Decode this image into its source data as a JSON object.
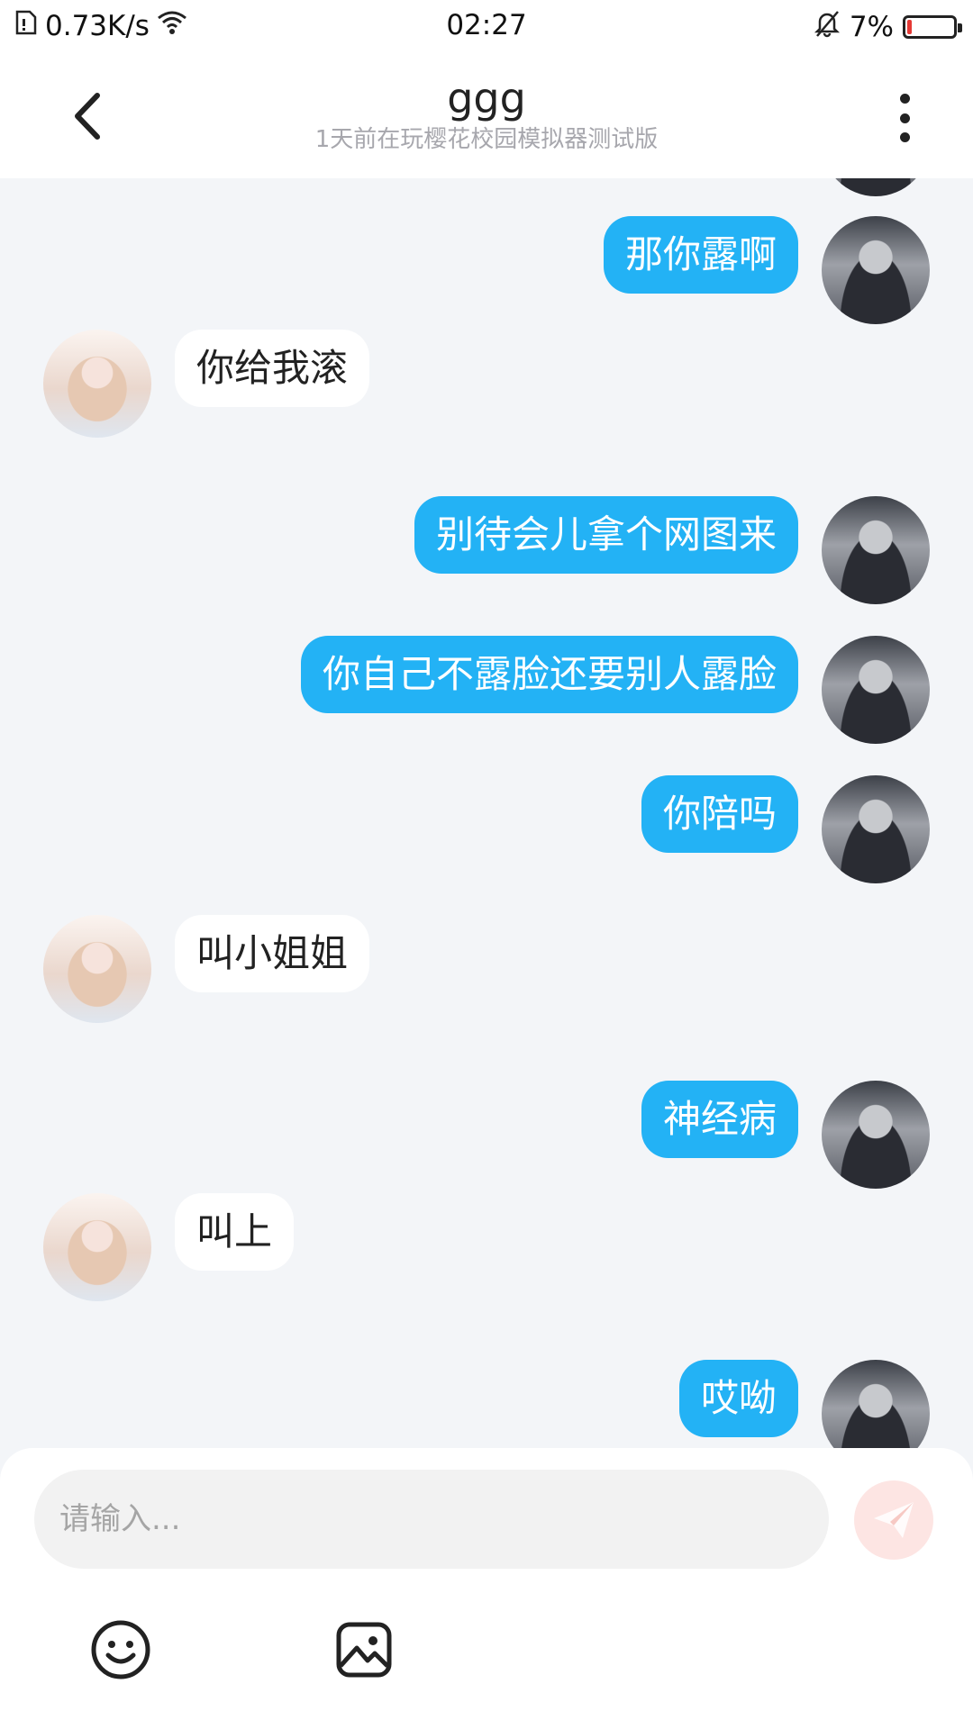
{
  "status_bar": {
    "network_speed": "0.73K/s",
    "time": "02:27",
    "battery": "7%",
    "battery_level": 0.07
  },
  "header": {
    "title": "ggg",
    "subtitle": "1天前在玩樱花校园模拟器测试版"
  },
  "messages": [
    {
      "sender": "me",
      "text": "那你露啊"
    },
    {
      "sender": "them",
      "text": "你给我滚"
    },
    {
      "sender": "me",
      "text": "别待会儿拿个网图来"
    },
    {
      "sender": "me",
      "text": "你自己不露脸还要别人露脸"
    },
    {
      "sender": "me",
      "text": "你陪吗"
    },
    {
      "sender": "them",
      "text": "叫小姐姐"
    },
    {
      "sender": "me",
      "text": "神经病"
    },
    {
      "sender": "them",
      "text": "叫上"
    },
    {
      "sender": "me",
      "text": "哎呦"
    }
  ],
  "composer": {
    "placeholder": "请输入..."
  },
  "colors": {
    "accent": "#23b2f5",
    "chat_bg": "#f3f5f8",
    "send_button": "#fde5e3",
    "battery_low": "#e53935"
  },
  "icons": {
    "back": "back-arrow-icon",
    "more": "more-vertical-icon",
    "send": "paper-plane-icon",
    "emoji": "smiley-icon",
    "image": "image-icon"
  }
}
